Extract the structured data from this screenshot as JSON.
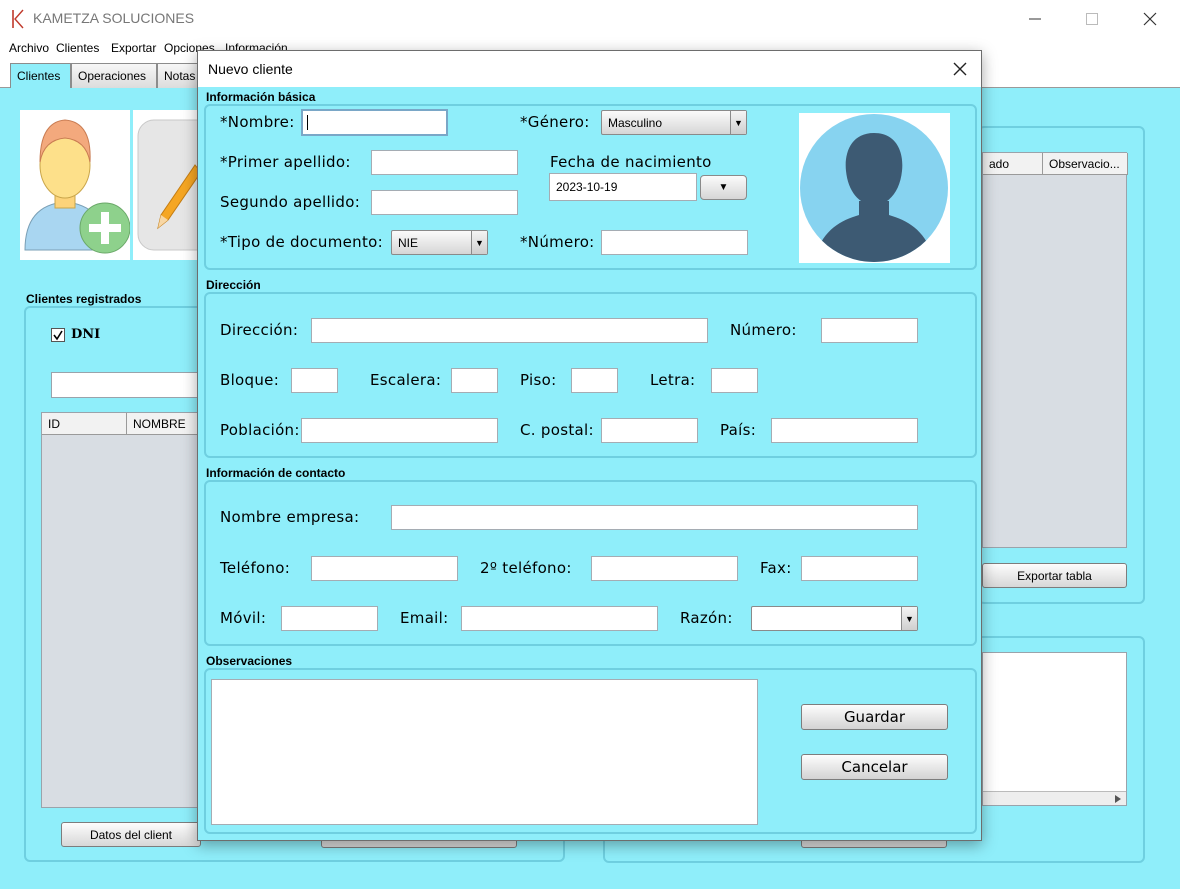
{
  "app": {
    "title": "KAMETZA SOLUCIONES",
    "menu": [
      "Archivo",
      "Clientes",
      "Exportar",
      "Opciones",
      "Información"
    ],
    "tabs": [
      "Clientes",
      "Operaciones",
      "Notas"
    ]
  },
  "background": {
    "registered_label": "Clientes registrados",
    "dni_label": "DNI",
    "left_table_headers": [
      "ID",
      "NOMBRE"
    ],
    "right_table_headers": [
      "ado",
      "Observacio..."
    ],
    "export_button": "Exportar tabla",
    "client_data_button": "Datos del client"
  },
  "dialog": {
    "title": "Nuevo cliente",
    "basic": {
      "section_title": "Información básica",
      "nombre_label": "*Nombre:",
      "nombre_value": "",
      "genero_label": "*Género:",
      "genero_value": "Masculino",
      "primer_apellido_label": "*Primer apellido:",
      "fecha_label": "Fecha de nacimiento",
      "fecha_value": "2023-10-19",
      "segundo_apellido_label": "Segundo apellido:",
      "tipo_doc_label": "*Tipo de documento:",
      "tipo_doc_value": "NIE",
      "numero_label": "*Número:"
    },
    "address": {
      "section_title": "Dirección",
      "direccion_label": "Dirección:",
      "numero_label": "Número:",
      "bloque_label": "Bloque:",
      "escalera_label": "Escalera:",
      "piso_label": "Piso:",
      "letra_label": "Letra:",
      "poblacion_label": "Población:",
      "cpostal_label": "C. postal:",
      "pais_label": "País:"
    },
    "contact": {
      "section_title": "Información de contacto",
      "empresa_label": "Nombre empresa:",
      "telefono_label": "Teléfono:",
      "telefono2_label": "2º teléfono:",
      "fax_label": "Fax:",
      "movil_label": "Móvil:",
      "email_label": "Email:",
      "razon_label": "Razón:"
    },
    "notes": {
      "section_title": "Observaciones",
      "save_button": "Guardar",
      "cancel_button": "Cancelar"
    }
  },
  "colors": {
    "background": "#8feefa",
    "border": "#6fcfe0",
    "avatar_circle": "#87d3f0",
    "avatar_silhouette": "#3d5a73"
  }
}
